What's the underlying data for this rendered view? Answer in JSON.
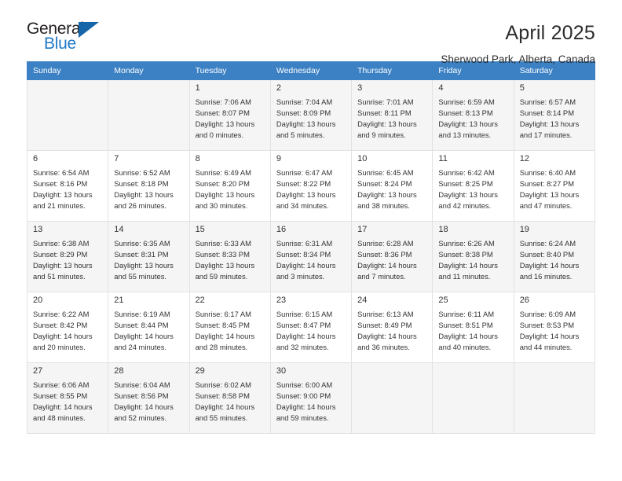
{
  "brand": {
    "name_top": "General",
    "name_bottom": "Blue",
    "triangle_color": "#1565a8",
    "blue_color": "#2079c7"
  },
  "header": {
    "title": "April 2025",
    "location": "Sherwood Park, Alberta, Canada"
  },
  "calendar": {
    "accent_color": "#3c81c4",
    "weekdays": [
      "Sunday",
      "Monday",
      "Tuesday",
      "Wednesday",
      "Thursday",
      "Friday",
      "Saturday"
    ],
    "weeks": [
      [
        {
          "day": "",
          "info": ""
        },
        {
          "day": "",
          "info": ""
        },
        {
          "day": "1",
          "info": "Sunrise: 7:06 AM\nSunset: 8:07 PM\nDaylight: 13 hours and 0 minutes."
        },
        {
          "day": "2",
          "info": "Sunrise: 7:04 AM\nSunset: 8:09 PM\nDaylight: 13 hours and 5 minutes."
        },
        {
          "day": "3",
          "info": "Sunrise: 7:01 AM\nSunset: 8:11 PM\nDaylight: 13 hours and 9 minutes."
        },
        {
          "day": "4",
          "info": "Sunrise: 6:59 AM\nSunset: 8:13 PM\nDaylight: 13 hours and 13 minutes."
        },
        {
          "day": "5",
          "info": "Sunrise: 6:57 AM\nSunset: 8:14 PM\nDaylight: 13 hours and 17 minutes."
        }
      ],
      [
        {
          "day": "6",
          "info": "Sunrise: 6:54 AM\nSunset: 8:16 PM\nDaylight: 13 hours and 21 minutes."
        },
        {
          "day": "7",
          "info": "Sunrise: 6:52 AM\nSunset: 8:18 PM\nDaylight: 13 hours and 26 minutes."
        },
        {
          "day": "8",
          "info": "Sunrise: 6:49 AM\nSunset: 8:20 PM\nDaylight: 13 hours and 30 minutes."
        },
        {
          "day": "9",
          "info": "Sunrise: 6:47 AM\nSunset: 8:22 PM\nDaylight: 13 hours and 34 minutes."
        },
        {
          "day": "10",
          "info": "Sunrise: 6:45 AM\nSunset: 8:24 PM\nDaylight: 13 hours and 38 minutes."
        },
        {
          "day": "11",
          "info": "Sunrise: 6:42 AM\nSunset: 8:25 PM\nDaylight: 13 hours and 42 minutes."
        },
        {
          "day": "12",
          "info": "Sunrise: 6:40 AM\nSunset: 8:27 PM\nDaylight: 13 hours and 47 minutes."
        }
      ],
      [
        {
          "day": "13",
          "info": "Sunrise: 6:38 AM\nSunset: 8:29 PM\nDaylight: 13 hours and 51 minutes."
        },
        {
          "day": "14",
          "info": "Sunrise: 6:35 AM\nSunset: 8:31 PM\nDaylight: 13 hours and 55 minutes."
        },
        {
          "day": "15",
          "info": "Sunrise: 6:33 AM\nSunset: 8:33 PM\nDaylight: 13 hours and 59 minutes."
        },
        {
          "day": "16",
          "info": "Sunrise: 6:31 AM\nSunset: 8:34 PM\nDaylight: 14 hours and 3 minutes."
        },
        {
          "day": "17",
          "info": "Sunrise: 6:28 AM\nSunset: 8:36 PM\nDaylight: 14 hours and 7 minutes."
        },
        {
          "day": "18",
          "info": "Sunrise: 6:26 AM\nSunset: 8:38 PM\nDaylight: 14 hours and 11 minutes."
        },
        {
          "day": "19",
          "info": "Sunrise: 6:24 AM\nSunset: 8:40 PM\nDaylight: 14 hours and 16 minutes."
        }
      ],
      [
        {
          "day": "20",
          "info": "Sunrise: 6:22 AM\nSunset: 8:42 PM\nDaylight: 14 hours and 20 minutes."
        },
        {
          "day": "21",
          "info": "Sunrise: 6:19 AM\nSunset: 8:44 PM\nDaylight: 14 hours and 24 minutes."
        },
        {
          "day": "22",
          "info": "Sunrise: 6:17 AM\nSunset: 8:45 PM\nDaylight: 14 hours and 28 minutes."
        },
        {
          "day": "23",
          "info": "Sunrise: 6:15 AM\nSunset: 8:47 PM\nDaylight: 14 hours and 32 minutes."
        },
        {
          "day": "24",
          "info": "Sunrise: 6:13 AM\nSunset: 8:49 PM\nDaylight: 14 hours and 36 minutes."
        },
        {
          "day": "25",
          "info": "Sunrise: 6:11 AM\nSunset: 8:51 PM\nDaylight: 14 hours and 40 minutes."
        },
        {
          "day": "26",
          "info": "Sunrise: 6:09 AM\nSunset: 8:53 PM\nDaylight: 14 hours and 44 minutes."
        }
      ],
      [
        {
          "day": "27",
          "info": "Sunrise: 6:06 AM\nSunset: 8:55 PM\nDaylight: 14 hours and 48 minutes."
        },
        {
          "day": "28",
          "info": "Sunrise: 6:04 AM\nSunset: 8:56 PM\nDaylight: 14 hours and 52 minutes."
        },
        {
          "day": "29",
          "info": "Sunrise: 6:02 AM\nSunset: 8:58 PM\nDaylight: 14 hours and 55 minutes."
        },
        {
          "day": "30",
          "info": "Sunrise: 6:00 AM\nSunset: 9:00 PM\nDaylight: 14 hours and 59 minutes."
        },
        {
          "day": "",
          "info": ""
        },
        {
          "day": "",
          "info": ""
        },
        {
          "day": "",
          "info": ""
        }
      ]
    ]
  }
}
